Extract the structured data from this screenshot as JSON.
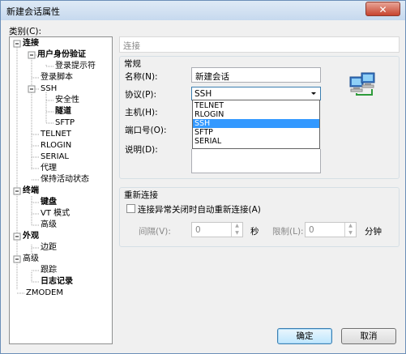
{
  "window": {
    "title": "新建会话属性",
    "close_glyph": "✕"
  },
  "category_label": "类别(C):",
  "tree": {
    "items": [
      {
        "label": "连接",
        "bold": true
      },
      {
        "label": "用户身份验证",
        "bold": true
      },
      {
        "label": "登录提示符",
        "bold": false
      },
      {
        "label": "登录脚本",
        "bold": false
      },
      {
        "label": "SSH",
        "bold": false
      },
      {
        "label": "安全性",
        "bold": false
      },
      {
        "label": "隧道",
        "bold": true
      },
      {
        "label": "SFTP",
        "bold": false
      },
      {
        "label": "TELNET",
        "bold": false
      },
      {
        "label": "RLOGIN",
        "bold": false
      },
      {
        "label": "SERIAL",
        "bold": false
      },
      {
        "label": "代理",
        "bold": false
      },
      {
        "label": "保持活动状态",
        "bold": false
      },
      {
        "label": "终端",
        "bold": true
      },
      {
        "label": "键盘",
        "bold": true
      },
      {
        "label": "VT 模式",
        "bold": false
      },
      {
        "label": "高级",
        "bold": false
      },
      {
        "label": "外观",
        "bold": true
      },
      {
        "label": "边距",
        "bold": false
      },
      {
        "label": "高级",
        "bold": false
      },
      {
        "label": "跟踪",
        "bold": false
      },
      {
        "label": "日志记录",
        "bold": true
      },
      {
        "label": "ZMODEM",
        "bold": false
      }
    ]
  },
  "panel": {
    "header": "连接",
    "general": {
      "title": "常规",
      "name_label": "名称(N):",
      "name_value": "新建会话",
      "protocol_label": "协议(P):",
      "protocol_value": "SSH",
      "host_label": "主机(H):",
      "port_label": "端口号(O):",
      "desc_label": "说明(D):",
      "protocol_options": [
        {
          "label": "TELNET",
          "selected": false
        },
        {
          "label": "RLOGIN",
          "selected": false
        },
        {
          "label": "SSH",
          "selected": true
        },
        {
          "label": "SFTP",
          "selected": false
        },
        {
          "label": "SERIAL",
          "selected": false
        }
      ]
    },
    "reconnect": {
      "title": "重新连接",
      "checkbox_label": "连接异常关闭时自动重新连接(A)",
      "interval_label": "间隔(V):",
      "interval_value": "0",
      "seconds_unit": "秒",
      "limit_label": "限制(L):",
      "limit_value": "0",
      "minutes_unit": "分钟"
    }
  },
  "buttons": {
    "ok": "确定",
    "cancel": "取消"
  },
  "icons": {
    "network": "network-computers-icon",
    "combo_arrow": "chevron-down-icon"
  },
  "colors": {
    "selection": "#3399ff",
    "title_bar": "#c6d9ee",
    "close_button": "#c7442f"
  }
}
